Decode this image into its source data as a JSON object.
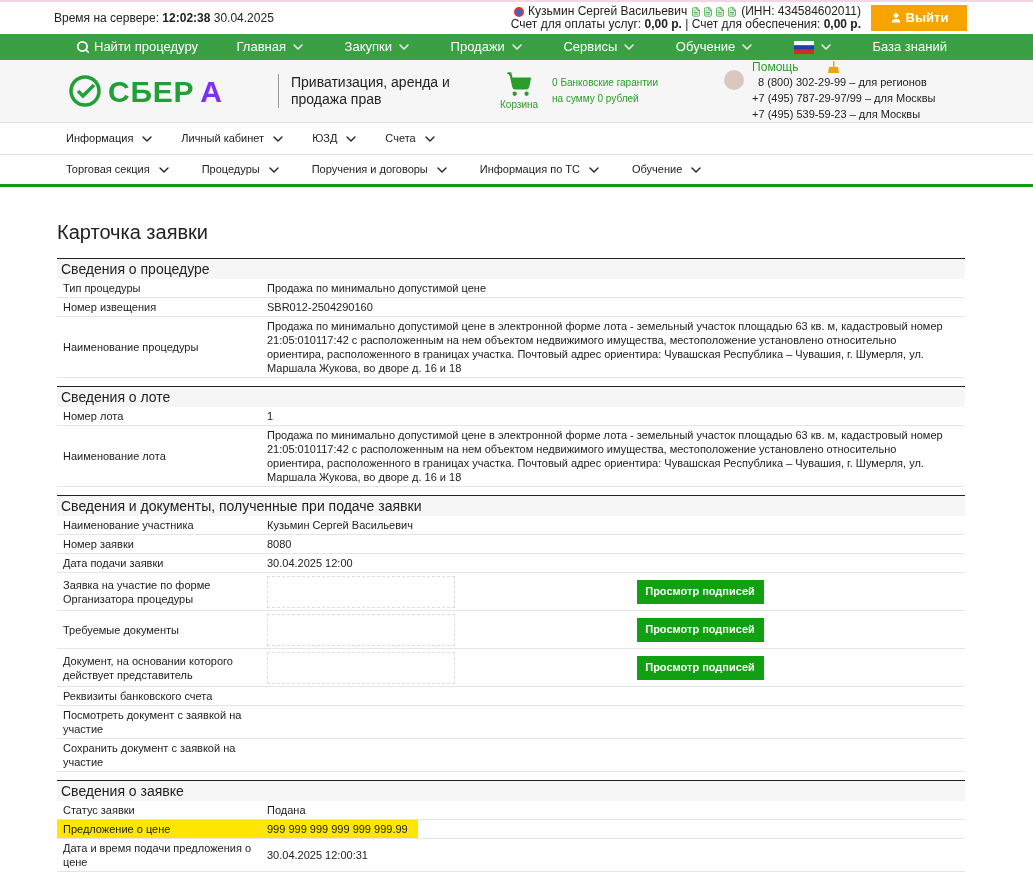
{
  "top_bar": {
    "server_time": "Время на сервере: **12:02:38** 30.04.2025",
    "user_name": "Кузьмин Сергей Васильевич",
    "inn": "(ИНН: 434584602011)",
    "accounts": "Счет для оплаты услуг: **0,00 р.** | Счет для обеспечения: **0,00 р.**",
    "logout": "Выйти"
  },
  "main_nav": [
    {
      "label": "Найти процедуру",
      "kind": "search"
    },
    {
      "label": "Главная",
      "kind": "dropdown"
    },
    {
      "label": "Закупки",
      "kind": "dropdown"
    },
    {
      "label": "Продажи",
      "kind": "dropdown"
    },
    {
      "label": "Сервисы",
      "kind": "dropdown"
    },
    {
      "label": "Обучение",
      "kind": "dropdown"
    },
    {
      "kind": "flag"
    },
    {
      "label": "База знаний",
      "kind": "link"
    }
  ],
  "header": {
    "logo_word": "СБЕР",
    "logo_letter": "А",
    "tagline": "Приватизация, аренда и продажа прав",
    "cart": "Корзина",
    "guarantees": [
      "0 Банковские гарантии",
      "на сумму 0 рублей"
    ],
    "help": "Помощь",
    "phones": [
      "8 (800) 302-29-99 – для регионов",
      "+7 (495) 787-29-97/99 – для Москвы",
      "+7 (495) 539-59-23 – для Москвы"
    ]
  },
  "menu_1": [
    "Информация",
    "Личный кабинет",
    "ЮЗД",
    "Счета"
  ],
  "menu_2": [
    "Торговая секция",
    "Процедуры",
    "Поручения и договоры",
    "Информация по ТС",
    "Обучение"
  ],
  "page_title": "Карточка заявки",
  "sections": [
    {
      "title": "Сведения о процедуре",
      "rows": [
        {
          "kind": "text",
          "label": "Тип процедуры",
          "value": "Продажа по минимально допустимой цене",
          "highlight": false
        },
        {
          "kind": "text",
          "label": "Номер извещения",
          "value": "SBR012-2504290160",
          "highlight": false
        },
        {
          "kind": "text",
          "label": "Наименование процедуры",
          "value": "Продажа по минимально допустимой цене в электронной форме лота - земельный участок площадью 63 кв. м, кадастровый номер 21:05:010117:42 с расположенным на нем объектом недвижимого имущества, местоположение установлено относительно ориентира, расположенного в границах участка. Почтовый адрес ориентира: Чувашская Республика – Чувашия, г. Шумерля, ул. Маршала Жукова, во дворе д. 16 и 18",
          "highlight": false
        }
      ]
    },
    {
      "title": "Сведения о лоте",
      "rows": [
        {
          "kind": "text",
          "label": "Номер лота",
          "value": "1",
          "highlight": false
        },
        {
          "kind": "text",
          "label": "Наименование лота",
          "value": "Продажа по минимально допустимой цене в электронной форме лота - земельный участок площадью 63 кв. м, кадастровый номер 21:05:010117:42 с расположенным на нем объектом недвижимого имущества, местоположение установлено относительно ориентира, расположенного в границах участка. Почтовый адрес ориентира: Чувашская Республика – Чувашия, г. Шумерля, ул. Маршала Жукова, во дворе д. 16 и 18",
          "highlight": false
        }
      ]
    },
    {
      "title": "Сведения и документы, полученные при подаче заявки",
      "rows": [
        {
          "kind": "text",
          "label": "Наименование участника",
          "value": "Кузьмин Сергей Васильевич",
          "highlight": false
        },
        {
          "kind": "text",
          "label": "Номер заявки",
          "value": "8080",
          "highlight": false
        },
        {
          "kind": "text",
          "label": "Дата подачи заявки",
          "value": "30.04.2025 12:00",
          "highlight": false
        },
        {
          "kind": "document",
          "label": "Заявка на участие по форме Организатора процедуры",
          "button": "Просмотр подписей",
          "highlight": false
        },
        {
          "kind": "document",
          "label": "Требуемые документы",
          "button": "Просмотр подписей",
          "highlight": false
        },
        {
          "kind": "document",
          "label": "Документ, на основании которого действует представитель",
          "button": "Просмотр подписей",
          "highlight": false
        },
        {
          "kind": "text",
          "label": "Реквизиты банковского счета",
          "highlight": false
        },
        {
          "kind": "text",
          "label": "Посмотреть документ с заявкой на участие",
          "highlight": false
        },
        {
          "kind": "text",
          "label": "Сохранить документ с заявкой на участие",
          "highlight": false
        }
      ]
    },
    {
      "title": "Сведения о заявке",
      "rows": [
        {
          "kind": "text",
          "label": "Статус заявки",
          "value": "Подана",
          "highlight": false
        },
        {
          "kind": "text",
          "label": "Предложение о цене",
          "value": "999 999 999 999 999 999.99",
          "highlight": true
        },
        {
          "kind": "text",
          "label": "Дата и время подачи предложения о цене",
          "value": "30.04.2025 12:00:31",
          "highlight": false
        }
      ]
    }
  ]
}
